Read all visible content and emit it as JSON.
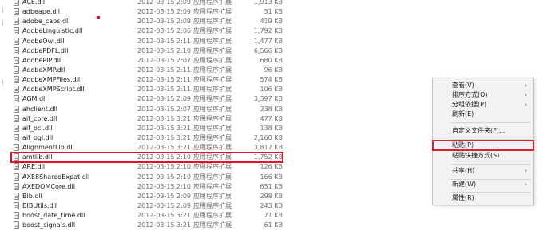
{
  "files": [
    {
      "name": "ACE.dll",
      "date": "2012-03-15 2:09",
      "type": "应用程序扩展",
      "size": "1,913 KB"
    },
    {
      "name": "adbeape.dll",
      "date": "2012-03-15 2:09",
      "type": "应用程序扩展",
      "size": "31 KB"
    },
    {
      "name": "adobe_caps.dll",
      "date": "2012-03-15 2:09",
      "type": "应用程序扩展",
      "size": "419 KB"
    },
    {
      "name": "AdobeLinguistic.dll",
      "date": "2012-03-15 2:06",
      "type": "应用程序扩展",
      "size": "1,792 KB"
    },
    {
      "name": "AdobeOwl.dll",
      "date": "2012-03-15 2:11",
      "type": "应用程序扩展",
      "size": "1,477 KB"
    },
    {
      "name": "AdobePDFL.dll",
      "date": "2012-03-15 2:10",
      "type": "应用程序扩展",
      "size": "6,566 KB"
    },
    {
      "name": "AdobePIP.dll",
      "date": "2012-03-15 2:07",
      "type": "应用程序扩展",
      "size": "680 KB"
    },
    {
      "name": "AdobeXMP.dll",
      "date": "2012-03-15 2:11",
      "type": "应用程序扩展",
      "size": "96 KB"
    },
    {
      "name": "AdobeXMPFiles.dll",
      "date": "2012-03-15 2:11",
      "type": "应用程序扩展",
      "size": "574 KB"
    },
    {
      "name": "AdobeXMPScript.dll",
      "date": "2012-03-15 2:11",
      "type": "应用程序扩展",
      "size": "106 KB"
    },
    {
      "name": "AGM.dll",
      "date": "2012-03-15 2:09",
      "type": "应用程序扩展",
      "size": "3,397 KB"
    },
    {
      "name": "ahclient.dll",
      "date": "2012-03-15 2:07",
      "type": "应用程序扩展",
      "size": "238 KB"
    },
    {
      "name": "aif_core.dll",
      "date": "2012-03-15 3:21",
      "type": "应用程序扩展",
      "size": "477 KB"
    },
    {
      "name": "aif_ocl.dll",
      "date": "2012-03-15 3:21",
      "type": "应用程序扩展",
      "size": "138 KB"
    },
    {
      "name": "aif_ogl.dll",
      "date": "2012-03-15 3:21",
      "type": "应用程序扩展",
      "size": "2,160 KB"
    },
    {
      "name": "AlignmentLib.dll",
      "date": "2012-03-15 3:21",
      "type": "应用程序扩展",
      "size": "3,817 KB"
    },
    {
      "name": "amtlib.dll",
      "date": "2012-03-15 2:10",
      "type": "应用程序扩展",
      "size": "1,752 KB"
    },
    {
      "name": "ARE.dll",
      "date": "2012-03-15 2:10",
      "type": "应用程序扩展",
      "size": "126 KB"
    },
    {
      "name": "AXE8SharedExpat.dll",
      "date": "2012-03-15 2:10",
      "type": "应用程序扩展",
      "size": "166 KB"
    },
    {
      "name": "AXEDOMCore.dll",
      "date": "2012-03-15 2:10",
      "type": "应用程序扩展",
      "size": "651 KB"
    },
    {
      "name": "Bib.dll",
      "date": "2012-03-15 2:09",
      "type": "应用程序扩展",
      "size": "298 KB"
    },
    {
      "name": "BIBUtils.dll",
      "date": "2012-03-15 2:09",
      "type": "应用程序扩展",
      "size": "243 KB"
    },
    {
      "name": "boost_date_time.dll",
      "date": "2012-03-15 3:21",
      "type": "应用程序扩展",
      "size": "71 KB"
    },
    {
      "name": "boost_signals.dll",
      "date": "2012-03-15 3:21",
      "type": "应用程序扩展",
      "size": "61 KB"
    }
  ],
  "selected_index": 16,
  "context_menu": {
    "items": [
      {
        "label": "查看(V)",
        "arrow": true
      },
      {
        "label": "排序方式(O)",
        "arrow": true
      },
      {
        "label": "分组依据(P)",
        "arrow": true
      },
      {
        "label": "刷新(E)",
        "arrow": false
      },
      {
        "label": "自定义文件夹(F)...",
        "arrow": false
      },
      {
        "label": "粘贴(P)",
        "arrow": false
      },
      {
        "label": "粘贴快捷方式(S)",
        "arrow": false
      },
      {
        "label": "共享(H)",
        "arrow": true
      },
      {
        "label": "新建(W)",
        "arrow": true
      },
      {
        "label": "属性(R)",
        "arrow": false
      }
    ],
    "highlighted_index": 5
  },
  "colors": {
    "highlight_border": "#e81123",
    "menu_bg": "#f2f2f2"
  }
}
